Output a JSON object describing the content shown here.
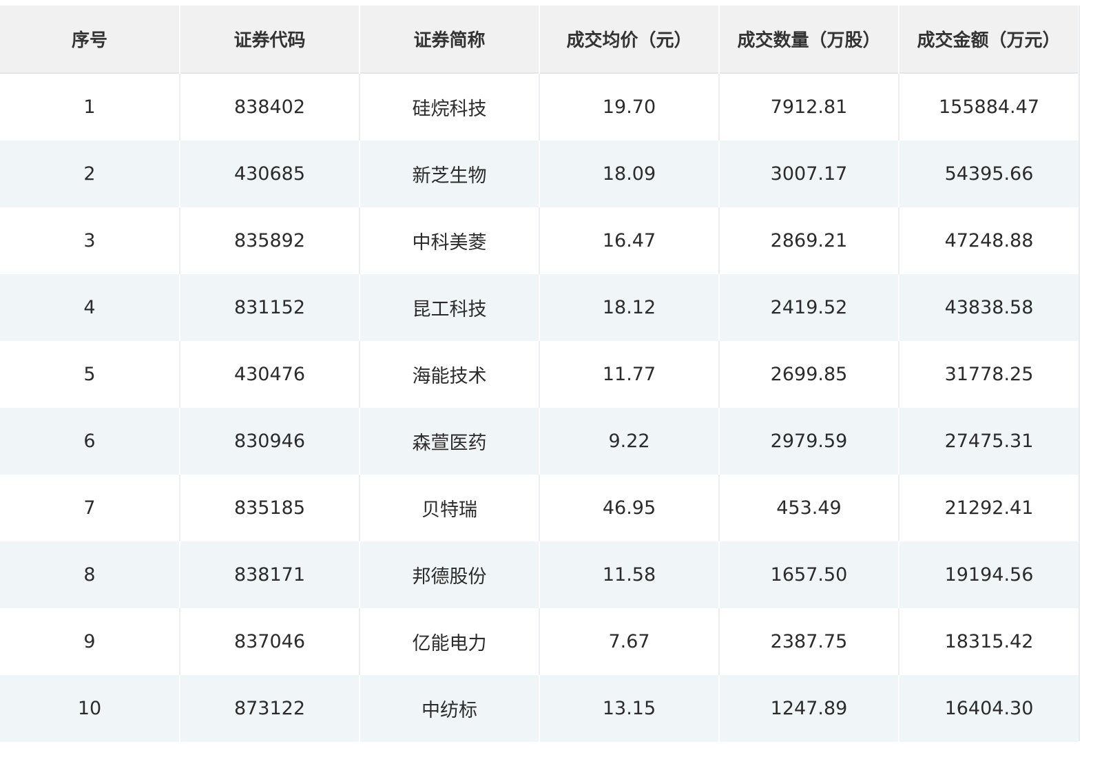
{
  "chart_data": {
    "type": "table",
    "columns": [
      "序号",
      "证券代码",
      "证券简称",
      "成交均价（元）",
      "成交数量（万股）",
      "成交金额（万元）"
    ],
    "rows": [
      [
        "1",
        "838402",
        "硅烷科技",
        "19.70",
        "7912.81",
        "155884.47"
      ],
      [
        "2",
        "430685",
        "新芝生物",
        "18.09",
        "3007.17",
        "54395.66"
      ],
      [
        "3",
        "835892",
        "中科美菱",
        "16.47",
        "2869.21",
        "47248.88"
      ],
      [
        "4",
        "831152",
        "昆工科技",
        "18.12",
        "2419.52",
        "43838.58"
      ],
      [
        "5",
        "430476",
        "海能技术",
        "11.77",
        "2699.85",
        "31778.25"
      ],
      [
        "6",
        "830946",
        "森萱医药",
        "9.22",
        "2979.59",
        "27475.31"
      ],
      [
        "7",
        "835185",
        "贝特瑞",
        "46.95",
        "453.49",
        "21292.41"
      ],
      [
        "8",
        "838171",
        "邦德股份",
        "11.58",
        "1657.50",
        "19194.56"
      ],
      [
        "9",
        "837046",
        "亿能电力",
        "7.67",
        "2387.75",
        "18315.42"
      ],
      [
        "10",
        "873122",
        "中纺标",
        "13.15",
        "1247.89",
        "16404.30"
      ]
    ]
  },
  "colors": {
    "header_bg": "#f1f1f1",
    "row_alt_bg": "#f0f5f8",
    "row_bg": "#ffffff",
    "text": "#2b2b2b"
  }
}
